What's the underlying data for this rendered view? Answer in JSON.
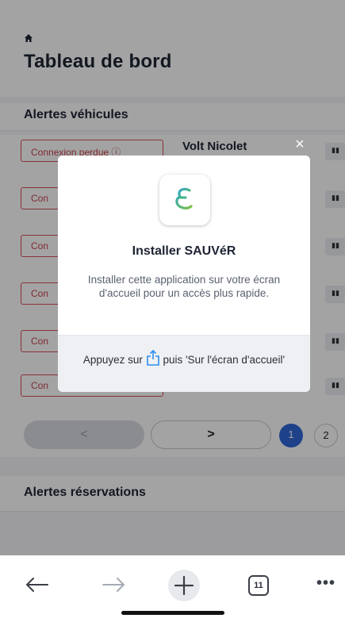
{
  "header": {
    "title": "Tableau de bord",
    "home_icon": "home-icon"
  },
  "vehicle_alerts": {
    "title": "Alertes véhicules",
    "rows": [
      {
        "badge": "Connexion perdue",
        "vehicle": "Volt Nicolet"
      },
      {
        "badge": "Con",
        "vehicle": ""
      },
      {
        "badge": "Con",
        "vehicle": ""
      },
      {
        "badge": "Con",
        "vehicle": ""
      },
      {
        "badge": "Con",
        "vehicle": ""
      },
      {
        "badge": "Con",
        "vehicle": ""
      }
    ],
    "row_action_icon": "chart-icon"
  },
  "pagination": {
    "prev": "<",
    "next": ">",
    "pages": [
      "1",
      "2"
    ],
    "active_page": "1"
  },
  "reservation_alerts": {
    "title": "Alertes réservations"
  },
  "modal": {
    "close": "×",
    "title": "Installer SAUVéR",
    "description": "Installer cette application sur votre écran d'accueil pour un accès plus rapide.",
    "footer_before": "Appuyez sur",
    "footer_after": "puis 'Sur l'écran d'accueil'",
    "share_icon": "share-icon",
    "app_icon": "sauver-logo-icon"
  },
  "toolbar": {
    "back": "←",
    "forward": "→",
    "new_tab": "+",
    "tab_count": "11",
    "more": "•••"
  },
  "colors": {
    "accent": "#2f66d8",
    "alert": "#d6505a",
    "overlay": "rgba(0,0,0,0.36)"
  }
}
